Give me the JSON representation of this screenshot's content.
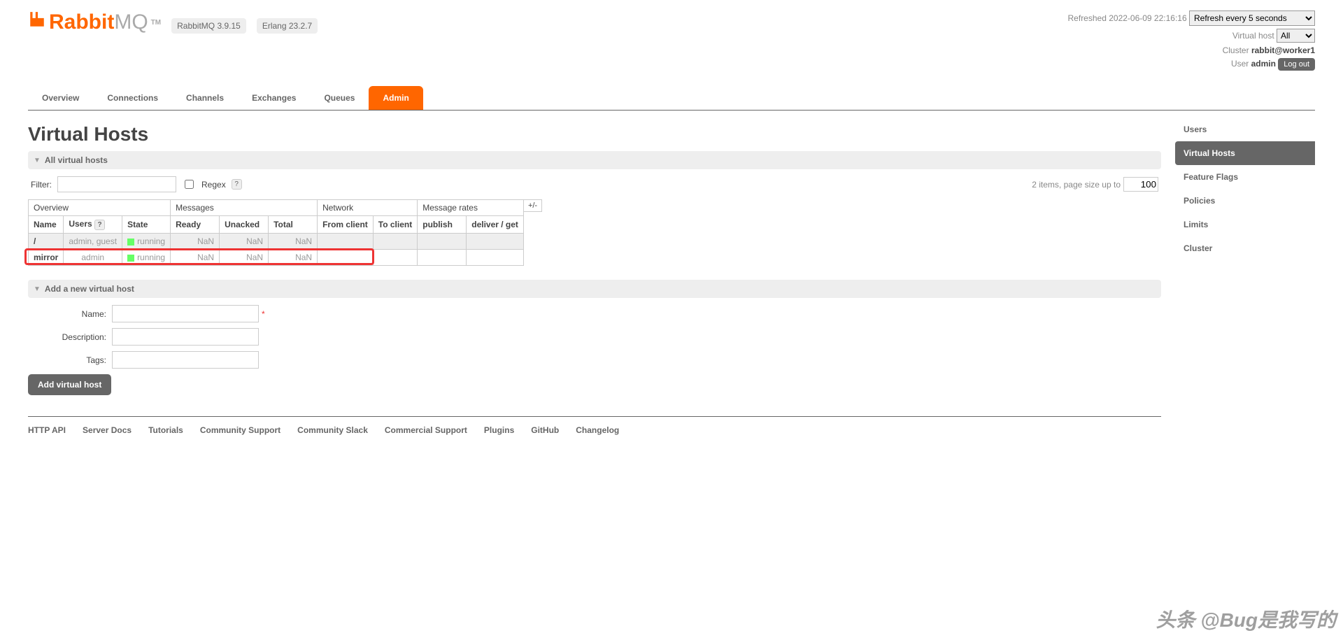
{
  "header": {
    "logo_rabbit": "Rabbit",
    "logo_mq": "MQ",
    "tm": "TM",
    "version_rabbit": "RabbitMQ 3.9.15",
    "version_erlang": "Erlang 23.2.7",
    "refreshed_prefix": "Refreshed ",
    "refreshed_time": "2022-06-09 22:16:16",
    "refresh_select": "Refresh every 5 seconds",
    "vhost_label": "Virtual host",
    "vhost_select": "All",
    "cluster_label": "Cluster ",
    "cluster_name": "rabbit@worker1",
    "user_label": "User ",
    "user_name": "admin",
    "logout": "Log out"
  },
  "nav": {
    "tabs": [
      "Overview",
      "Connections",
      "Channels",
      "Exchanges",
      "Queues",
      "Admin"
    ],
    "active": "Admin"
  },
  "page": {
    "title": "Virtual Hosts",
    "section_all": "All virtual hosts",
    "filter_label": "Filter:",
    "regex_label": "Regex",
    "help_q": "?",
    "items_text_a": "2 items, page size up to",
    "page_size": "100",
    "plus_minus": "+/-"
  },
  "table": {
    "groups": {
      "overview": "Overview",
      "messages": "Messages",
      "network": "Network",
      "rates": "Message rates"
    },
    "cols": {
      "name": "Name",
      "users": "Users",
      "state": "State",
      "ready": "Ready",
      "unacked": "Unacked",
      "total": "Total",
      "from_client": "From client",
      "to_client": "To client",
      "publish": "publish",
      "deliver_get": "deliver / get"
    },
    "rows": [
      {
        "name": "/",
        "users": "admin, guest",
        "state": "running",
        "ready": "NaN",
        "unacked": "NaN",
        "total": "NaN",
        "from_client": "",
        "to_client": "",
        "publish": "",
        "deliver_get": ""
      },
      {
        "name": "mirror",
        "users": "admin",
        "state": "running",
        "ready": "NaN",
        "unacked": "NaN",
        "total": "NaN",
        "from_client": "",
        "to_client": "",
        "publish": "",
        "deliver_get": ""
      }
    ]
  },
  "add_form": {
    "section": "Add a new virtual host",
    "name_label": "Name:",
    "desc_label": "Description:",
    "tags_label": "Tags:",
    "required": "*",
    "submit": "Add virtual host"
  },
  "sidebar": {
    "items": [
      "Users",
      "Virtual Hosts",
      "Feature Flags",
      "Policies",
      "Limits",
      "Cluster"
    ],
    "active": "Virtual Hosts"
  },
  "footer": {
    "links": [
      "HTTP API",
      "Server Docs",
      "Tutorials",
      "Community Support",
      "Community Slack",
      "Commercial Support",
      "Plugins",
      "GitHub",
      "Changelog"
    ]
  },
  "watermark": "头条 @Bug是我写的"
}
